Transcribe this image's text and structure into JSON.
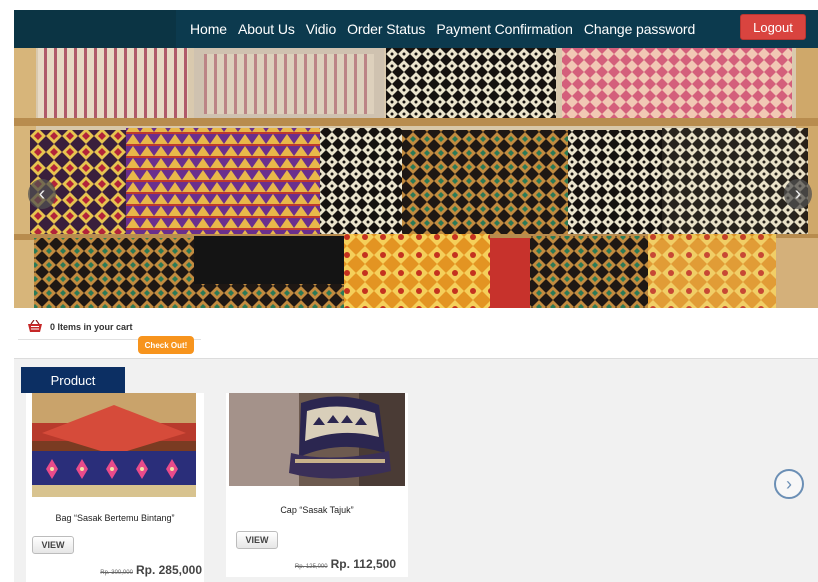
{
  "nav": {
    "items": [
      "Home",
      "About Us",
      "Vidio",
      "Order Status",
      "Payment Confirmation",
      "Change password"
    ],
    "logout_label": "Logout"
  },
  "banner": {
    "prev_icon": "‹",
    "next_icon": "›"
  },
  "cart": {
    "text": "0 Items in your cart",
    "checkout_label": "Check Out!"
  },
  "products": {
    "section_title": "Product",
    "next_icon": "›",
    "items": [
      {
        "name": "Bag “Sasak Bertemu Bintang”",
        "view_label": "VIEW",
        "old_price": "Rp. 300,000",
        "price": "Rp. 285,000"
      },
      {
        "name": "Cap “Sasak Tajuk”",
        "view_label": "VIEW",
        "old_price": "Rp. 125,000",
        "price": "Rp. 112,500"
      }
    ]
  },
  "colors": {
    "navbar": "#0c3a4e",
    "logout": "#d9443f",
    "section_tab": "#0c2f63",
    "checkout": "#f7941d"
  }
}
